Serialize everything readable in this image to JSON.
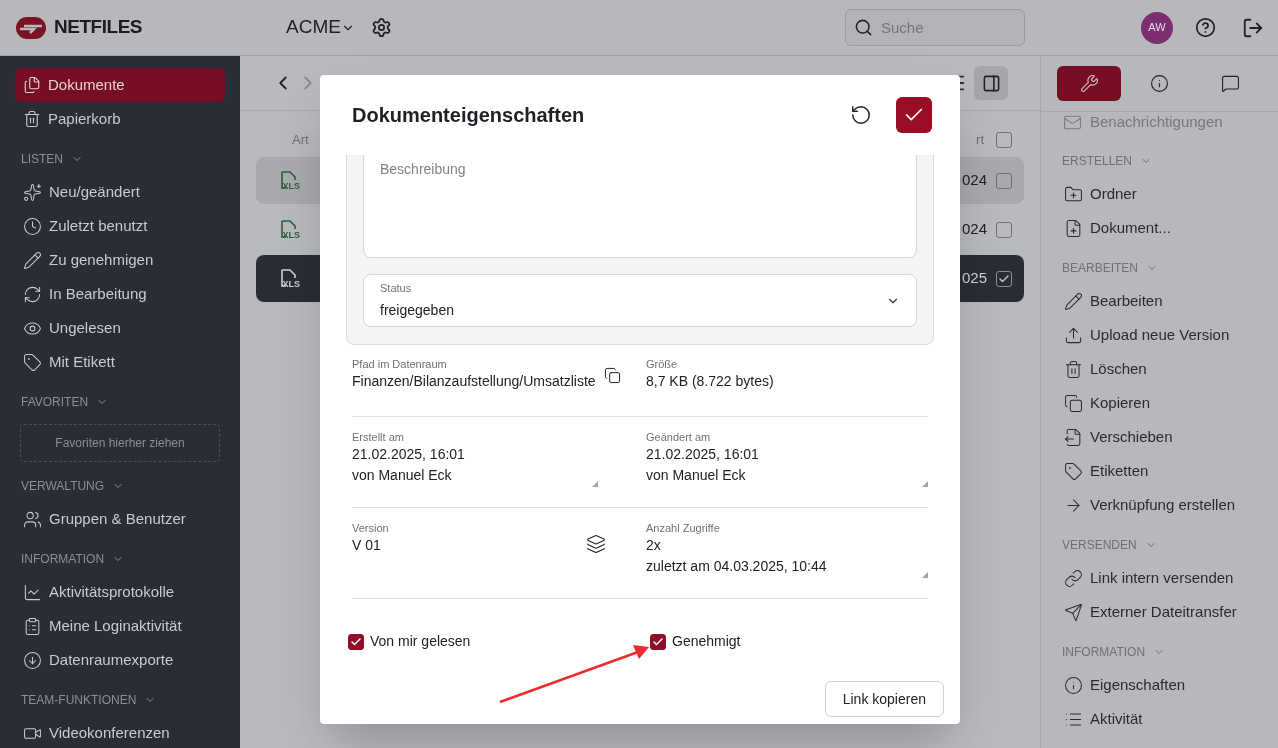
{
  "header": {
    "logo": "NETFILES",
    "workspace": "ACME",
    "search": {
      "placeholder": "Suche"
    },
    "avatar": "AW"
  },
  "sidebar": {
    "items": [
      {
        "label": "Dokumente",
        "selected": true
      },
      {
        "label": "Papierkorb",
        "selected": false
      }
    ],
    "sections": [
      {
        "title": "LISTEN",
        "items": [
          {
            "label": "Neu/geändert"
          },
          {
            "label": "Zuletzt benutzt"
          },
          {
            "label": "Zu genehmigen"
          },
          {
            "label": "In Bearbeitung"
          },
          {
            "label": "Ungelesen"
          },
          {
            "label": "Mit Etikett"
          }
        ]
      },
      {
        "title": "FAVORITEN",
        "dropzone": "Favoriten hierher ziehen"
      },
      {
        "title": "VERWALTUNG",
        "items": [
          {
            "label": "Gruppen & Benutzer"
          }
        ]
      },
      {
        "title": "INFORMATION",
        "items": [
          {
            "label": "Aktivitätsprotokolle"
          },
          {
            "label": "Meine Loginaktivität"
          },
          {
            "label": "Datenraumexporte"
          }
        ]
      },
      {
        "title": "TEAM-FUNKTIONEN",
        "items": [
          {
            "label": "Videokonferenzen"
          }
        ]
      }
    ]
  },
  "file_list": {
    "columns": [
      "Art",
      "rt"
    ],
    "select_all": {
      "checked": false
    },
    "rows": [
      {
        "type": "XLS",
        "date": "024",
        "highlighted": true,
        "selected": false,
        "checked": false
      },
      {
        "type": "XLS",
        "date": "024",
        "highlighted": false,
        "selected": false,
        "checked": false
      },
      {
        "type": "XLS",
        "date": "025",
        "highlighted": false,
        "selected": true,
        "checked": true
      }
    ]
  },
  "right_panel": {
    "tabs": [
      {
        "selected": true
      },
      {
        "selected": false
      },
      {
        "selected": false
      }
    ],
    "top_item": "Benachrichtigungen",
    "sections": [
      {
        "title": "ERSTELLEN",
        "items": [
          "Ordner",
          "Dokument..."
        ]
      },
      {
        "title": "BEARBEITEN",
        "items": [
          "Bearbeiten",
          "Upload neue Version",
          "Löschen",
          "Kopieren",
          "Verschieben",
          "Etiketten",
          "Verknüpfung erstellen"
        ]
      },
      {
        "title": "VERSENDEN",
        "items": [
          "Link intern versenden",
          "Externer Dateitransfer"
        ]
      },
      {
        "title": "INFORMATION",
        "items": [
          "Eigenschaften",
          "Aktivität"
        ]
      }
    ]
  },
  "dialog": {
    "title": "Dokumenteigenschaften",
    "description": {
      "placeholder": "Beschreibung"
    },
    "status": {
      "label": "Status",
      "value": "freigegeben"
    },
    "fields": [
      {
        "label": "Pfad im Datenraum",
        "lines": [
          "Finanzen/Bilanzaufstellung/Umsatzliste"
        ],
        "kind": "copy"
      },
      {
        "label": "Größe",
        "lines": [
          "8,7 KB (8.722 bytes)"
        ],
        "kind": "plain"
      },
      {
        "label": "Erstellt am",
        "lines": [
          "21.02.2025, 16:01",
          "von Manuel Eck"
        ],
        "kind": "resizable"
      },
      {
        "label": "Geändert am",
        "lines": [
          "21.02.2025, 16:01",
          "von Manuel Eck"
        ],
        "kind": "resizable"
      },
      {
        "label": "Version",
        "lines": [
          "V 01"
        ],
        "kind": "versions"
      },
      {
        "label": "Anzahl Zugriffe",
        "lines": [
          "2x",
          "zuletzt am 04.03.2025, 10:44"
        ],
        "kind": "resizable"
      }
    ],
    "checkboxes": [
      {
        "label": "Von mir gelesen",
        "checked": true
      },
      {
        "label": "Genehmigt",
        "checked": true
      }
    ],
    "copy_link_button": "Link kopieren"
  }
}
